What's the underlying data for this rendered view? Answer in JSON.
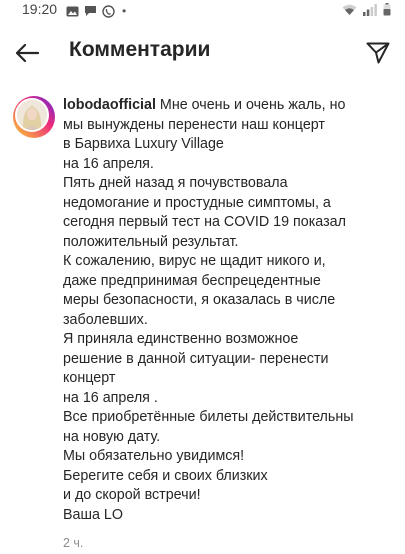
{
  "status_bar": {
    "time": "19:20",
    "dot": "•",
    "left_icons": [
      "gallery-icon",
      "message-icon",
      "phone-icon"
    ],
    "right_icons": [
      "wifi-icon",
      "signal-icon",
      "battery-icon"
    ]
  },
  "header": {
    "title": "Комментарии",
    "back_icon": "back-arrow-icon",
    "share_icon": "send-icon"
  },
  "comment": {
    "username": "lobodaofficial",
    "first_line_text": "Мне очень и очень жаль, но",
    "lines": [
      "мы вынуждены перенести наш  концерт",
      "в Барвиха Luxury Village",
      "на 16 апреля.",
      "Пять дней назад я почувствовала",
      "недомогание и простудные симптомы, а",
      "сегодня первый тест на COVID 19 показал",
      "положительный результат.",
      "К сожалению, вирус не щадит никого и,",
      "даже предпринимая беспрецедентные",
      "меры безопасности, я оказалась в числе",
      "заболевших.",
      "Я приняла единственно возможное",
      "решение в данной ситуации- перенести",
      "концерт",
      "на 16 апреля .",
      "Все приобретённые билеты действительны",
      "на новую дату.",
      "Мы обязательно увидимся!",
      "Берегите себя и своих близких",
      "и до скорой встречи!",
      "Ваша LO"
    ],
    "time": "2 ч."
  },
  "colors": {
    "text": "#262626",
    "secondary_text": "#8e8e8e",
    "background": "#ffffff"
  }
}
